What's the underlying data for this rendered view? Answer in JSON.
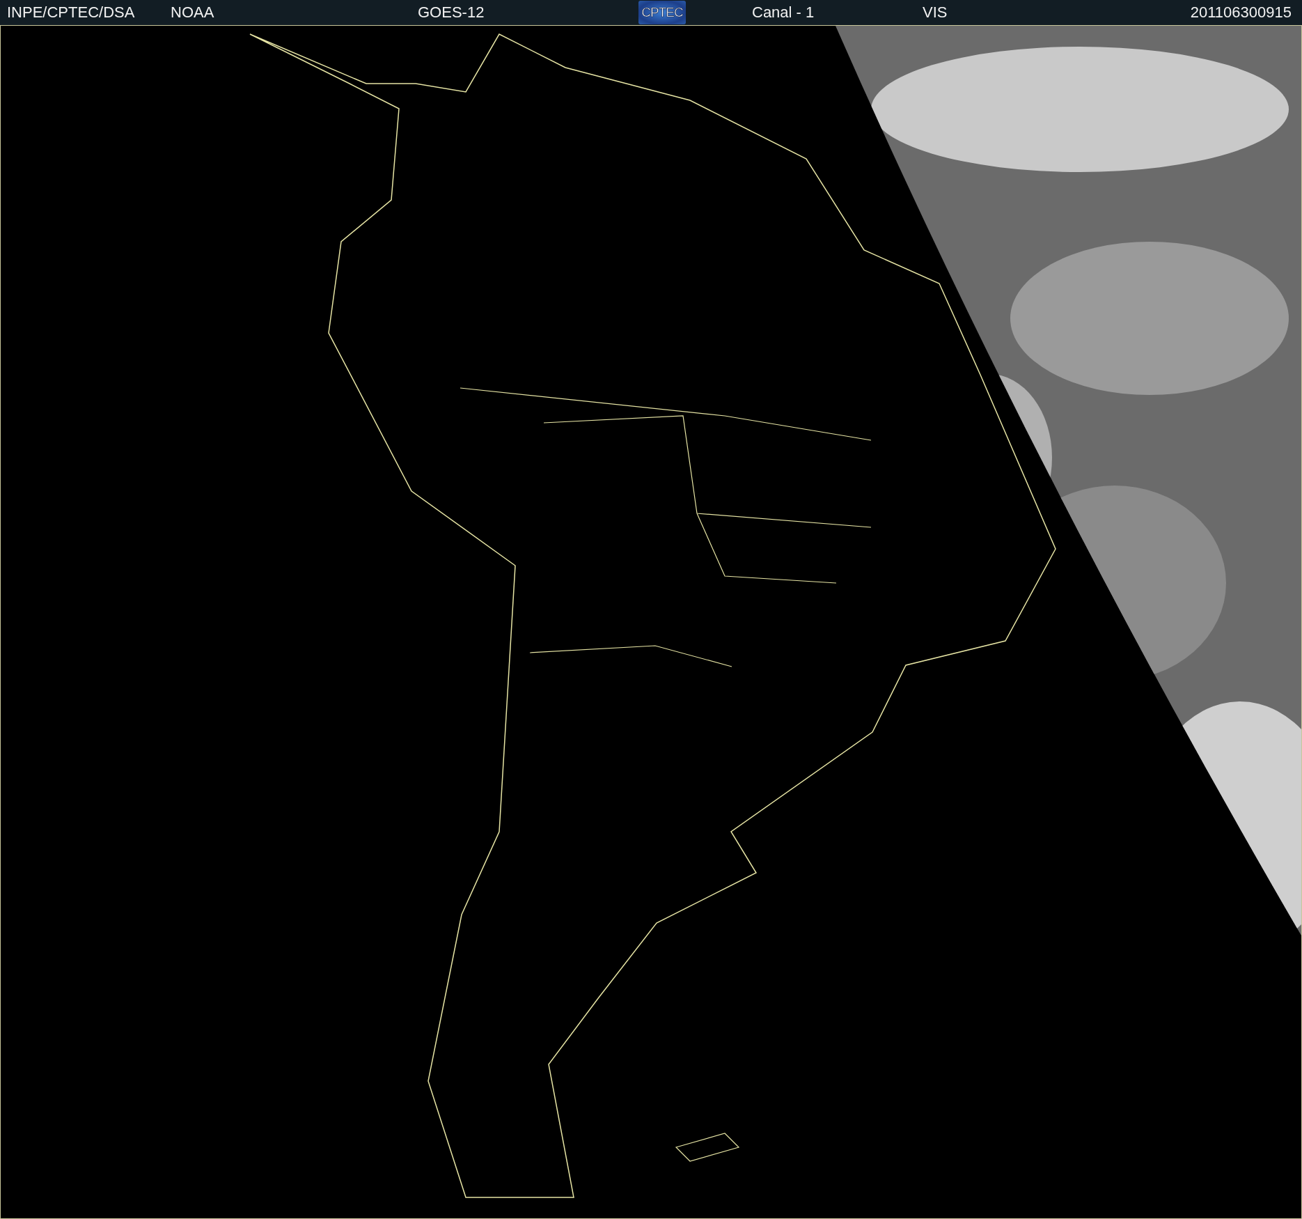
{
  "header": {
    "source": "INPE/CPTEC/DSA",
    "agency": "NOAA",
    "satellite": "GOES-12",
    "logo_text": "CPTEC",
    "channel": "Canal - 1",
    "band": "VIS",
    "timestamp": "201106300915"
  }
}
